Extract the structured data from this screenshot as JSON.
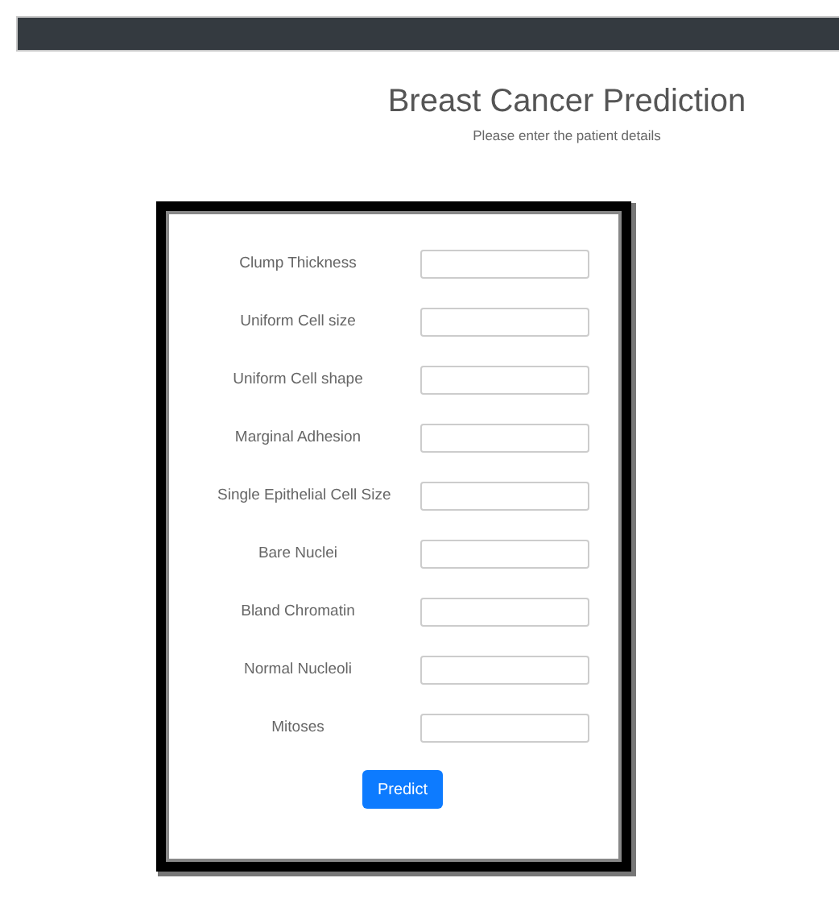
{
  "header": {
    "title": "Breast Cancer Prediction",
    "subtitle": "Please enter the patient details"
  },
  "fields": [
    {
      "label": "Clump Thickness"
    },
    {
      "label": "Uniform Cell size"
    },
    {
      "label": "Uniform Cell shape"
    },
    {
      "label": "Marginal Adhesion"
    },
    {
      "label": "Single Epithelial Cell Size"
    },
    {
      "label": "Bare Nuclei"
    },
    {
      "label": "Bland Chromatin"
    },
    {
      "label": "Normal Nucleoli"
    },
    {
      "label": "Mitoses"
    }
  ],
  "submit_button": "Predict"
}
